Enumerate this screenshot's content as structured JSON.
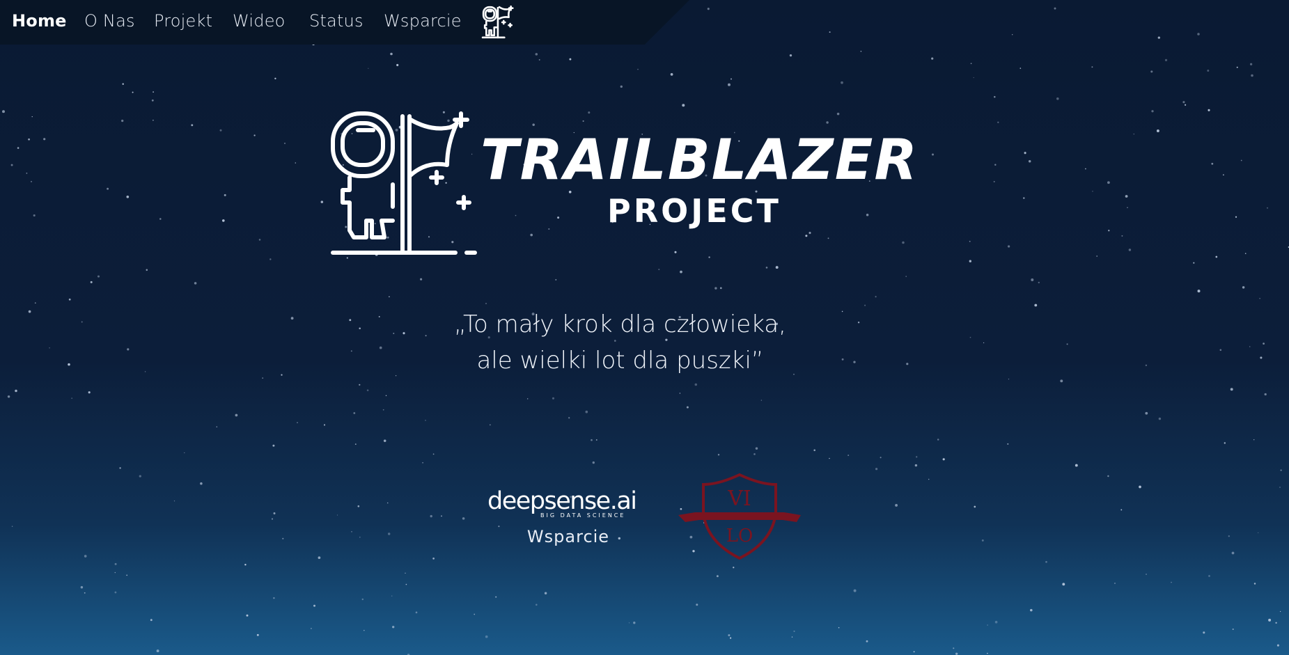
{
  "nav": {
    "items": [
      {
        "label": "Home",
        "active": true
      },
      {
        "label": "O Nas",
        "active": false
      },
      {
        "label": "Projekt",
        "active": false
      },
      {
        "label": "Wideo",
        "active": false
      },
      {
        "label": "Status",
        "active": false
      },
      {
        "label": "Wsparcie",
        "active": false
      }
    ],
    "logo_icon": "astronaut-flag-icon"
  },
  "hero": {
    "title": "TRAILBLAZER",
    "subtitle": "PROJECT",
    "icon": "astronaut-flag-icon",
    "quote_line1": "„To mały krok dla człowieka,",
    "quote_line2": "ale wielki lot dla puszki”"
  },
  "sponsors": {
    "deepsense_name": "deepsense.ai",
    "deepsense_tagline": "BIG DATA SCIENCE",
    "support_label": "Wsparcie",
    "school_top": "VI",
    "school_bottom": "LO",
    "school_color": "#7a1420"
  },
  "colors": {
    "background_top": "#0a1a33",
    "background_bottom": "#1a5a8a",
    "nav_background": "#081526",
    "text": "#ffffff"
  }
}
